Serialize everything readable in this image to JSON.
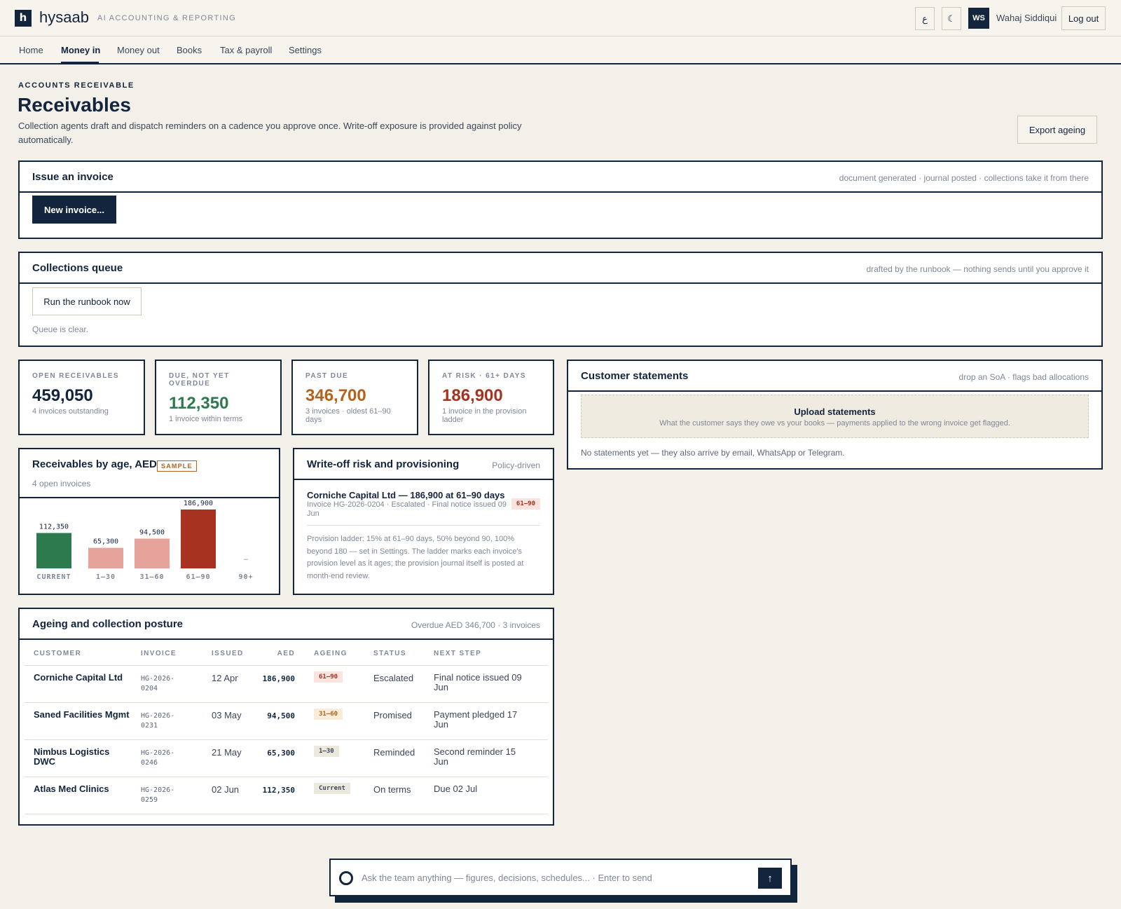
{
  "app": {
    "logo_letter": "h",
    "brand": "hysaab",
    "tagline": "AI ACCOUNTING & REPORTING",
    "lang_toggle": "ع",
    "theme_toggle": "☾",
    "user_initials": "WS",
    "user_name": "Wahaj Siddiqui",
    "logout_label": "Log out"
  },
  "nav": {
    "items": [
      "Home",
      "Money in",
      "Money out",
      "Books",
      "Tax & payroll",
      "Settings"
    ],
    "active": "Money in"
  },
  "page": {
    "eyebrow": "ACCOUNTS RECEIVABLE",
    "title": "Receivables",
    "description": "Collection agents draft and dispatch reminders on a cadence you approve once. Write-off exposure is provided against policy automatically.",
    "export_label": "Export ageing"
  },
  "issue_invoice": {
    "title": "Issue an invoice",
    "note": "document generated · journal posted · collections take it from there",
    "button": "New invoice..."
  },
  "collections": {
    "title": "Collections queue",
    "note": "drafted by the runbook — nothing sends until you approve it",
    "button": "Run the runbook now",
    "empty": "Queue is clear."
  },
  "kpis": [
    {
      "label": "OPEN RECEIVABLES",
      "value": "459,050",
      "sub": "4 invoices outstanding",
      "color": "#13243d"
    },
    {
      "label": "DUE, NOT YET OVERDUE",
      "value": "112,350",
      "sub": "1 invoice within terms",
      "color": "#2e7a4f"
    },
    {
      "label": "PAST DUE",
      "value": "346,700",
      "sub": "3 invoices · oldest 61–90 days",
      "color": "#b5621d"
    },
    {
      "label": "AT RISK · 61+ DAYS",
      "value": "186,900",
      "sub": "1 invoice in the provision ladder",
      "color": "#a6321f"
    }
  ],
  "statements": {
    "title": "Customer statements",
    "note": "drop an SoA · flags bad allocations",
    "upload_title": "Upload statements",
    "upload_sub": "What the customer says they owe vs your books — payments applied to the wrong invoice get flagged.",
    "empty": "No statements yet — they also arrive by email, WhatsApp or Telegram."
  },
  "ageing_chart": {
    "title": "Receivables by age, AED",
    "badge": "SAMPLE",
    "subtitle": "4 open invoices",
    "empty_marker": "–"
  },
  "chart_data": {
    "type": "bar",
    "title": "Receivables by age, AED",
    "categories": [
      "CURRENT",
      "1–30",
      "31–60",
      "61–90",
      "90+"
    ],
    "values": [
      112350,
      65300,
      94500,
      186900,
      null
    ],
    "value_labels": [
      "112,350",
      "65,300",
      "94,500",
      "186,900",
      ""
    ],
    "colors": [
      "#2e7a4f",
      "#e6a39c",
      "#e6a39c",
      "#a6321f",
      "#cfc9bb"
    ],
    "ylim": [
      0,
      186900
    ],
    "grid": false,
    "legend": "none"
  },
  "writeoff": {
    "title": "Write-off risk and provisioning",
    "note": "Policy-driven",
    "item_title": "Corniche Capital Ltd — 186,900 at 61–90 days",
    "item_meta": "Invoice HG-2026-0204 · Escalated · Final notice issued 09 Jun",
    "item_badge": "61–90",
    "policy_text": "Provision ladder: 15% at 61–90 days, 50% beyond 90, 100% beyond 180 — set in Settings. The ladder marks each invoice's provision level as it ages; the provision journal itself is posted at month-end review."
  },
  "ageing_table": {
    "title": "Ageing and collection posture",
    "note": "Overdue AED 346,700 · 3 invoices",
    "columns": [
      "CUSTOMER",
      "INVOICE",
      "ISSUED",
      "AED",
      "AGEING",
      "STATUS",
      "NEXT STEP"
    ],
    "rows": [
      {
        "customer": "Corniche Capital Ltd",
        "invoice": "HG-2026-0204",
        "issued": "12 Apr",
        "aed": "186,900",
        "ageing": "61–90",
        "ageing_tone": "red",
        "status": "Escalated",
        "next": "Final notice issued 09 Jun"
      },
      {
        "customer": "Saned Facilities Mgmt",
        "invoice": "HG-2026-0231",
        "issued": "03 May",
        "aed": "94,500",
        "ageing": "31–60",
        "ageing_tone": "amber",
        "status": "Promised",
        "next": "Payment pledged 17 Jun"
      },
      {
        "customer": "Nimbus Logistics DWC",
        "invoice": "HG-2026-0246",
        "issued": "21 May",
        "aed": "65,300",
        "ageing": "1–30",
        "ageing_tone": "gray",
        "status": "Reminded",
        "next": "Second reminder 15 Jun"
      },
      {
        "customer": "Atlas Med Clinics",
        "invoice": "HG-2026-0259",
        "issued": "02 Jun",
        "aed": "112,350",
        "ageing": "Current",
        "ageing_tone": "gray",
        "status": "On terms",
        "next": "Due 02 Jul"
      }
    ]
  },
  "ask": {
    "placeholder": "Ask the team anything — figures, decisions, schedules...  ·  Enter to send",
    "send_icon": "↑"
  }
}
